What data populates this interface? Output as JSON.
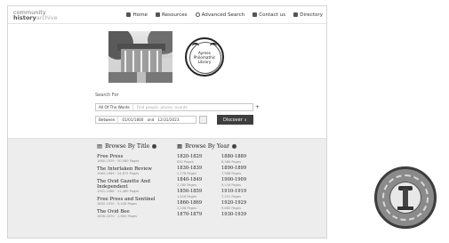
{
  "logo": {
    "line1": "community",
    "line2_bold": "history",
    "line2_light": "archive"
  },
  "nav": [
    {
      "icon": "home-icon",
      "label": "Home"
    },
    {
      "icon": "book-icon",
      "label": "Resources"
    },
    {
      "icon": "search-icon",
      "label": "Advanced Search"
    },
    {
      "icon": "envelope-icon",
      "label": "Contact us"
    },
    {
      "icon": "directory-icon",
      "label": "Directory"
    }
  ],
  "seal": {
    "line1": "Aymes",
    "line2": "Philomathic",
    "line3": "Library"
  },
  "search": {
    "label": "Search For",
    "scope": "All Of The Words",
    "placeholder": "Find people, places, events",
    "add": "+",
    "range_field": "Between",
    "from": "01/01/1800",
    "and": "and",
    "to": "12/31/2023",
    "button": "Discover"
  },
  "browse_title": {
    "heading": "Browse By Title",
    "items": [
      {
        "name": "Free Press",
        "meta": "1880-1929 · 30,580 Pages"
      },
      {
        "name": "The Interlaken Review",
        "meta": "1964-1989 · 24,872 Pages"
      },
      {
        "name": "The Ovid Gazette And Independent",
        "meta": "1901-1968 · 11,469 Pages"
      },
      {
        "name": "Free Press and Sentinel",
        "meta": "1892-1920 · 9,428 Pages"
      },
      {
        "name": "The Ovid Bee",
        "meta": "1858-1870 · 1,600 Pages"
      }
    ]
  },
  "browse_year": {
    "heading": "Browse By Year",
    "items": [
      {
        "range": "1820-1829",
        "pages": "832 Pages"
      },
      {
        "range": "1880-1889",
        "pages": "8,380 Pages"
      },
      {
        "range": "1830-1839",
        "pages": "2,276 Pages"
      },
      {
        "range": "1890-1899",
        "pages": "7,968 Pages"
      },
      {
        "range": "1840-1849",
        "pages": "2,180 Pages"
      },
      {
        "range": "1900-1909",
        "pages": "9,116 Pages"
      },
      {
        "range": "1850-1859",
        "pages": "1,616 Pages"
      },
      {
        "range": "1910-1919",
        "pages": "7,291 Pages"
      },
      {
        "range": "1860-1869",
        "pages": "2,208 Pages"
      },
      {
        "range": "1920-1929",
        "pages": "9,665 Pages"
      },
      {
        "range": "1870-1879",
        "pages": ""
      },
      {
        "range": "1930-1939",
        "pages": ""
      }
    ]
  }
}
